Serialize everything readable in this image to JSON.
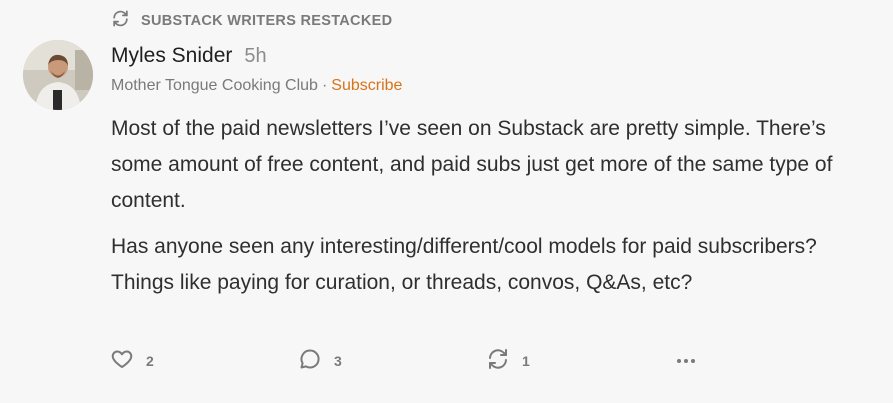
{
  "restack": {
    "label": "SUBSTACK WRITERS RESTACKED",
    "icon": "restack-icon"
  },
  "post": {
    "author": "Myles Snider",
    "time_ago": "5h",
    "publication": "Mother Tongue Cooking Club",
    "separator": "·",
    "subscribe_label": "Subscribe",
    "paragraphs": [
      "Most of the paid newsletters I’ve seen on Substack are pretty simple. There’s some amount of free content, and paid subs just get more of the same type of content.",
      "Has anyone seen any interesting/different/cool models for paid subscribers? Things like paying for curation, or threads, convos, Q&As, etc?"
    ]
  },
  "actions": {
    "likes": "2",
    "comments": "3",
    "restacks": "1"
  },
  "colors": {
    "accent": "#d9731a",
    "muted": "#7a7a7a",
    "text": "#2f2f2f",
    "background": "#f7f7f7"
  }
}
